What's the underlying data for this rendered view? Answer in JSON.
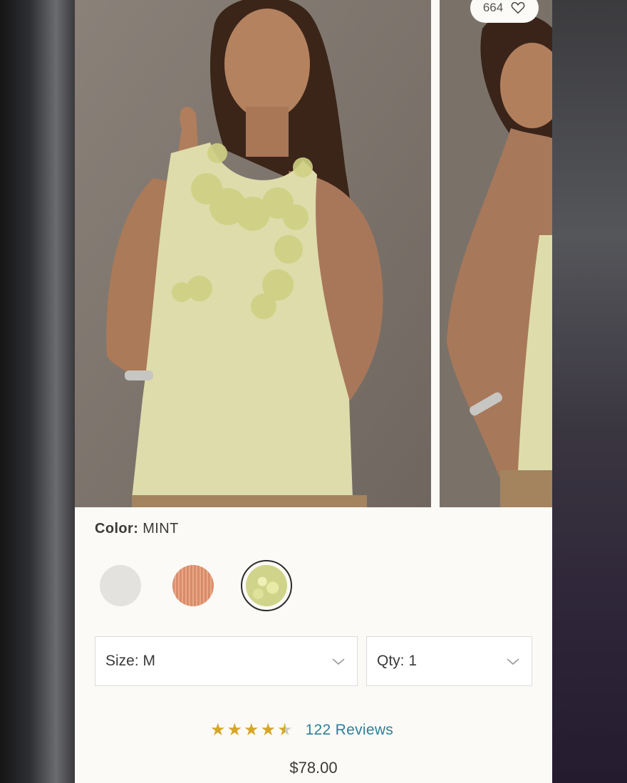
{
  "product": {
    "favorites_count": "664",
    "color_label": "Color:",
    "color_value": "MINT",
    "swatches": [
      {
        "name": "white",
        "color": "#e4e2de",
        "selected": false
      },
      {
        "name": "orange",
        "color": "#d98c6a",
        "selected": false
      },
      {
        "name": "mint",
        "color": "#cfd48a",
        "selected": true
      }
    ],
    "size_select": {
      "label": "Size: M"
    },
    "qty_select": {
      "label": "Qty: 1"
    },
    "rating": {
      "stars": 4.5,
      "reviews_label": "122 Reviews"
    },
    "price": "$78.00"
  },
  "icons": {
    "favorite": "heart-icon",
    "dropdown": "chevron-down-icon",
    "rating": "star-icon"
  },
  "colors": {
    "accent_link": "#2e7f9a",
    "star": "#d6a62a"
  }
}
